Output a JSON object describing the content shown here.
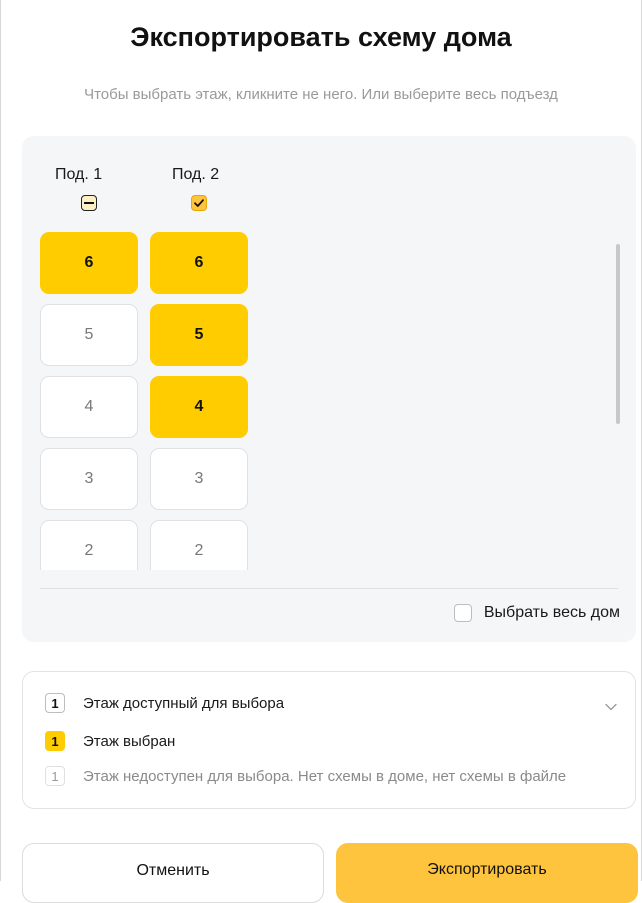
{
  "dialog": {
    "title": "Экспортировать схему дома",
    "subtitle": "Чтобы выбрать этаж, кликните не него. Или выберите весь подъезд"
  },
  "entrances": [
    {
      "label": "Под. 1",
      "checkbox_state": "indeterminate",
      "floors": [
        {
          "number": "6",
          "state": "selected"
        },
        {
          "number": "5",
          "state": "available"
        },
        {
          "number": "4",
          "state": "available"
        },
        {
          "number": "3",
          "state": "available"
        },
        {
          "number": "2",
          "state": "available"
        }
      ]
    },
    {
      "label": "Под. 2",
      "checkbox_state": "checked",
      "floors": [
        {
          "number": "6",
          "state": "selected"
        },
        {
          "number": "5",
          "state": "selected"
        },
        {
          "number": "4",
          "state": "selected"
        },
        {
          "number": "3",
          "state": "available"
        },
        {
          "number": "2",
          "state": "available"
        }
      ]
    }
  ],
  "select_whole_house": {
    "label": "Выбрать весь дом",
    "checked": false
  },
  "legend": {
    "items": [
      {
        "badge": "1",
        "style": "available",
        "text": "Этаж доступный для выбора"
      },
      {
        "badge": "1",
        "style": "selected",
        "text": "Этаж выбран"
      },
      {
        "badge": "1",
        "style": "unavailable",
        "text": "Этаж недоступен для выбора. Нет схемы в доме, нет схемы в файле"
      }
    ],
    "collapse_icon": "chevron-down-icon"
  },
  "buttons": {
    "cancel": "Отменить",
    "export": "Экспортировать"
  },
  "colors": {
    "accent": "#ffcc00",
    "button_accent": "#ffc43d",
    "panel_bg": "#f5f6f8"
  }
}
